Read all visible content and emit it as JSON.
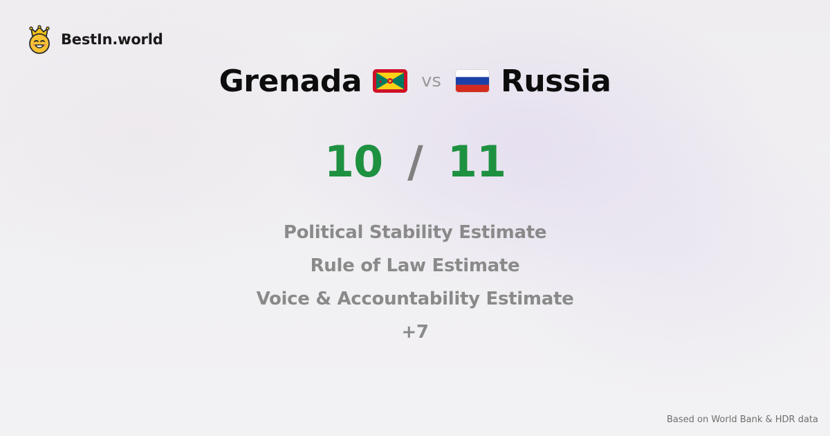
{
  "brand": {
    "name": "BestIn.world",
    "logo_icon": "crowned-smiley-icon"
  },
  "comparison": {
    "left_country": {
      "name": "Grenada",
      "flag_icon": "grenada-flag-icon"
    },
    "vs_label": "vs",
    "right_country": {
      "name": "Russia",
      "flag_icon": "russia-flag-icon"
    }
  },
  "scores": {
    "left": "10",
    "separator": "/",
    "right": "11",
    "color": "#1e9140"
  },
  "metrics": [
    "Political Stability Estimate",
    "Rule of Law Estimate",
    "Voice & Accountability Estimate",
    "+7"
  ],
  "footer": {
    "source": "Based on World Bank & HDR data"
  }
}
